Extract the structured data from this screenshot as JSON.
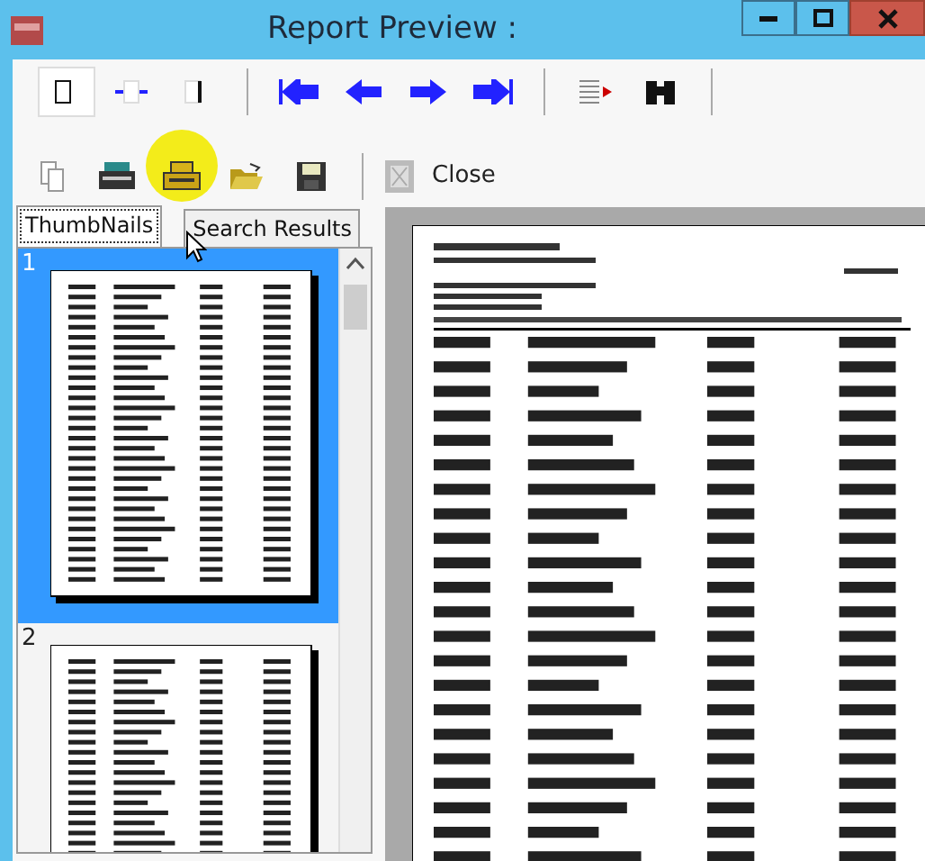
{
  "window": {
    "title": "Report Preview :"
  },
  "view_buttons": [
    {
      "selected": true
    },
    {
      "selected": false
    },
    {
      "selected": false
    }
  ],
  "close_button": {
    "label": "Close"
  },
  "tabs": [
    {
      "label": "ThumbNails",
      "selected": true
    },
    {
      "label": "Search Results",
      "selected": false
    }
  ],
  "thumbnails": [
    {
      "label": "1",
      "selected": true
    },
    {
      "label": "2",
      "selected": false
    }
  ]
}
